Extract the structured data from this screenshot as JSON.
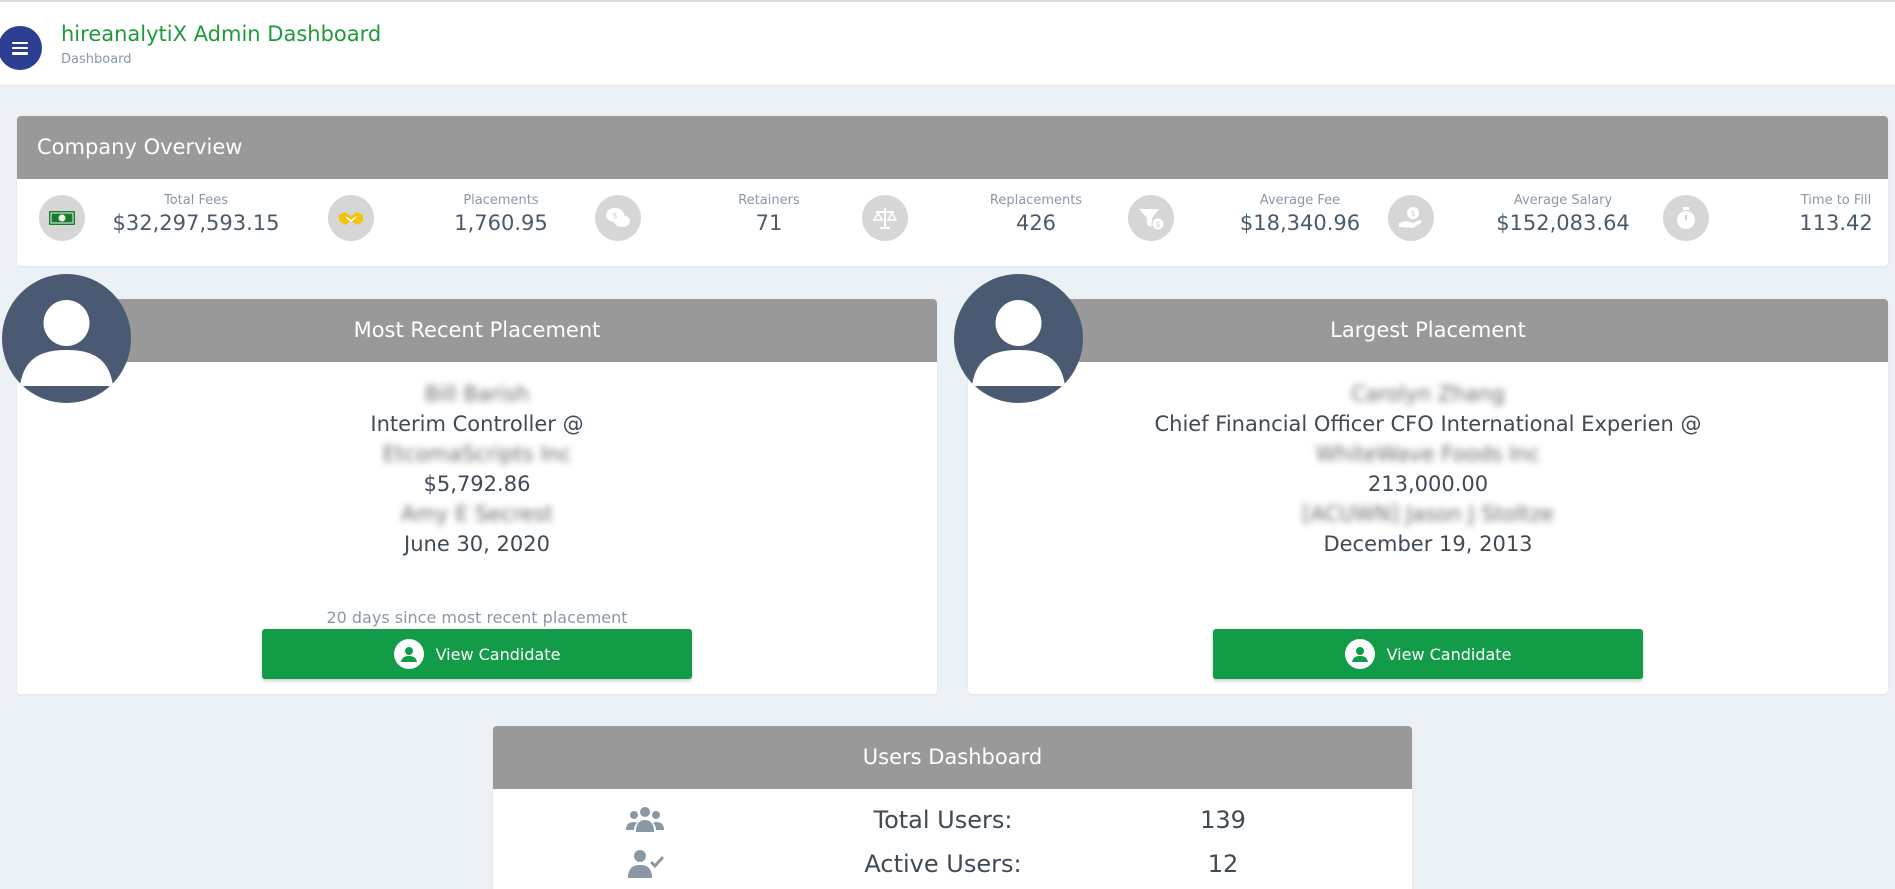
{
  "header": {
    "title": "hireanalytiX Admin Dashboard",
    "subtitle": "Dashboard",
    "menu_icon": "hamburger-menu-icon",
    "brand_color": "#1f9a3a",
    "menu_color": "#2c3e91"
  },
  "overview": {
    "title": "Company Overview",
    "stats": [
      {
        "label": "Total Fees",
        "value": "$32,297,593.15",
        "icon": "cash-icon"
      },
      {
        "label": "Placements",
        "value": "1,760.95",
        "icon": "handshake-icon"
      },
      {
        "label": "Retainers",
        "value": "71",
        "icon": "chat-dollar-icon"
      },
      {
        "label": "Replacements",
        "value": "426",
        "icon": "balance-scale-icon"
      },
      {
        "label": "Average Fee",
        "value": "$18,340.96",
        "icon": "funnel-dollar-icon"
      },
      {
        "label": "Average Salary",
        "value": "$152,083.64",
        "icon": "hand-dollar-icon"
      },
      {
        "label": "Time to Fill",
        "value": "113.42",
        "icon": "stopwatch-icon"
      }
    ]
  },
  "recent": {
    "title": "Most Recent Placement",
    "name": "Bill Barish",
    "position": "Interim Controller @",
    "company": "EtcomaScripts Inc",
    "amount": "$5,792.86",
    "recruiter": "Amy E Secrest",
    "date": "June 30, 2020",
    "since": "20 days since most recent placement",
    "button": "View Candidate"
  },
  "largest": {
    "title": "Largest Placement",
    "name": "Carolyn Zhang",
    "position": "Chief Financial Officer CFO International Experien @",
    "company": "WhiteWave Foods Inc",
    "amount": "213,000.00",
    "recruiter": "[ACUWN] Jason J Stoltze",
    "date": "December 19, 2013",
    "button": "View Candidate"
  },
  "users": {
    "title": "Users Dashboard",
    "rows": [
      {
        "label": "Total Users:",
        "value": "139",
        "icon": "users-group-icon"
      },
      {
        "label": "Active Users:",
        "value": "12",
        "icon": "user-check-icon"
      }
    ]
  },
  "colors": {
    "header_gray": "#999999",
    "button_green": "#139c48",
    "avatar": "#4a5a72",
    "background": "#ecf1f5"
  }
}
